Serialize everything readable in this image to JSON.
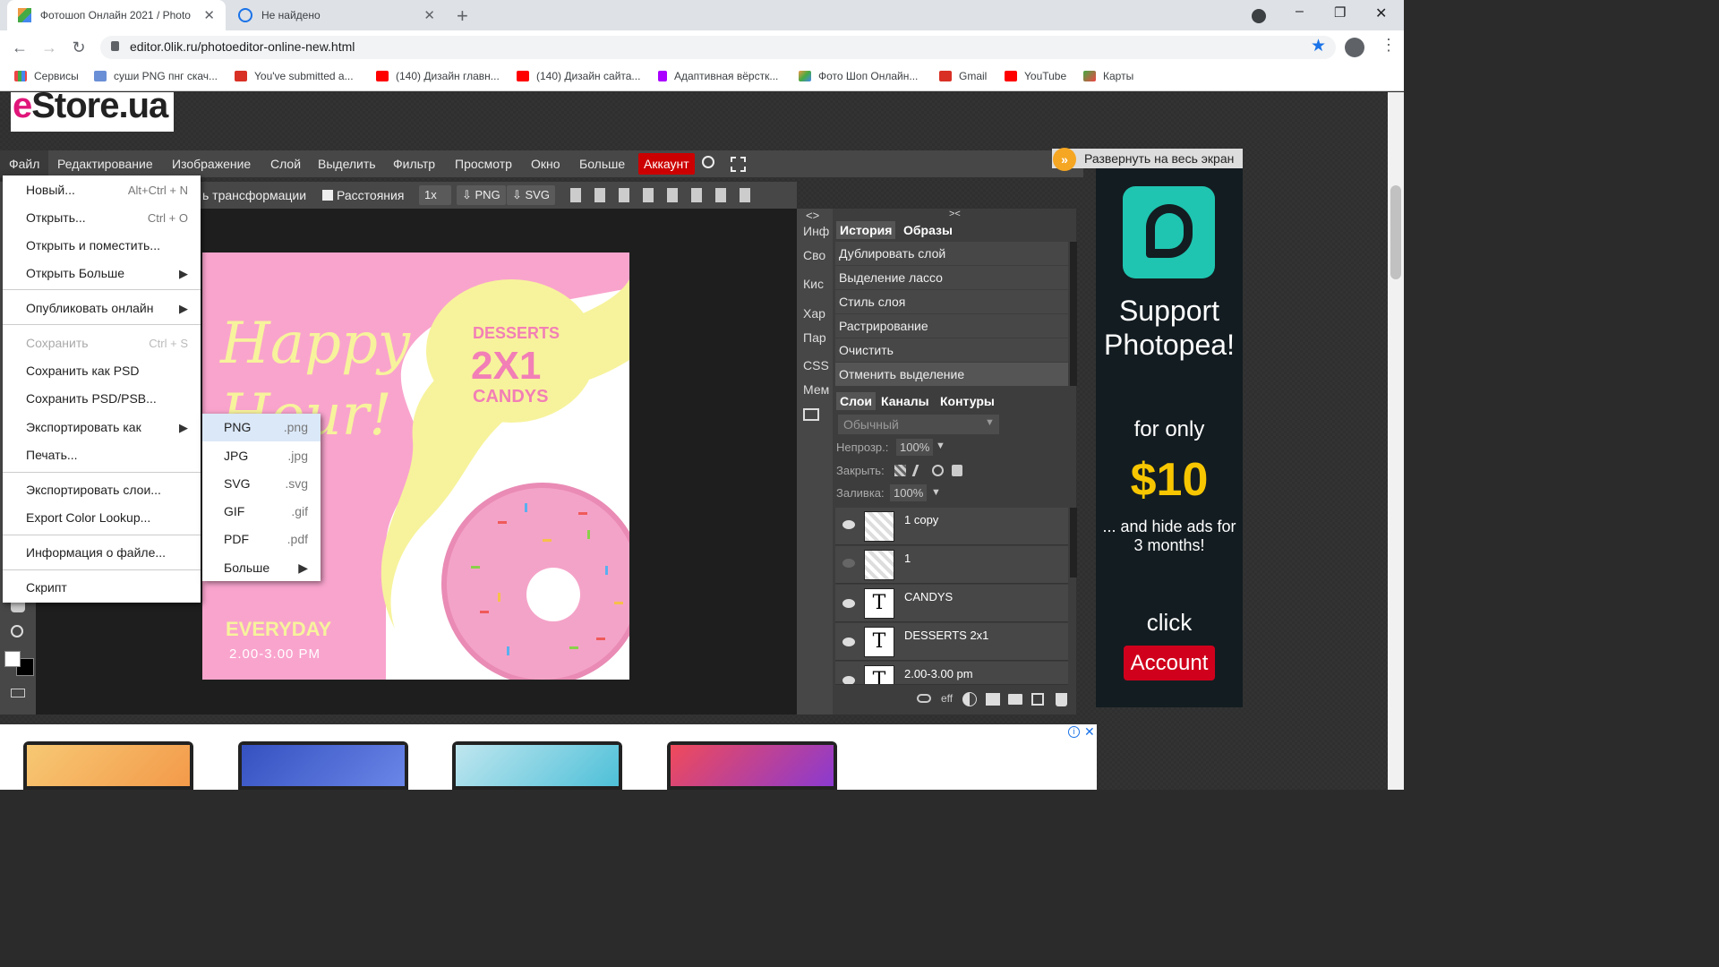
{
  "browser": {
    "tabs": [
      {
        "title": "Фотошоп Онлайн 2021 / Photo",
        "active": true
      },
      {
        "title": "Не найдено",
        "active": false
      }
    ],
    "new_tab": "+",
    "window_controls": [
      "–",
      "❐",
      "✕"
    ],
    "url": "editor.0lik.ru/photoeditor-online-new.html",
    "bookmarks": [
      "Сервисы",
      "суши PNG пнг скач...",
      "You've submitted a...",
      "(140) Дизайн главн...",
      "(140) Дизайн сайта...",
      "Адаптивная вёрстк...",
      "Фото Шоп Онлайн...",
      "Gmail",
      "YouTube",
      "Карты"
    ]
  },
  "site": {
    "logo_prefix": "e",
    "logo_text": "Store.ua"
  },
  "menubar": [
    "Файл",
    "Редактирование",
    "Изображение",
    "Слой",
    "Выделить",
    "Фильтр",
    "Просмотр",
    "Окно",
    "Больше"
  ],
  "account_label": "Аккаунт",
  "options_bar": {
    "transform": "ь трансформации",
    "distances": "Расстояния",
    "zoom": "1x",
    "png": "PNG",
    "svg": "SVG"
  },
  "file_menu": [
    {
      "label": "Новый...",
      "shortcut": "Alt+Ctrl + N"
    },
    {
      "label": "Открыть...",
      "shortcut": "Ctrl + O"
    },
    {
      "label": "Открыть и поместить...",
      "shortcut": ""
    },
    {
      "label": "Открыть Больше",
      "shortcut": "▶"
    },
    {
      "label": "Опубликовать онлайн",
      "shortcut": "▶"
    },
    {
      "label": "Сохранить",
      "shortcut": "Ctrl + S"
    },
    {
      "label": "Сохранить как PSD",
      "shortcut": ""
    },
    {
      "label": "Сохранить PSD/PSB...",
      "shortcut": ""
    },
    {
      "label": "Экспортировать как",
      "shortcut": "▶"
    },
    {
      "label": "Печать...",
      "shortcut": ""
    },
    {
      "label": "Экспортировать слои...",
      "shortcut": ""
    },
    {
      "label": "Export Color Lookup...",
      "shortcut": ""
    },
    {
      "label": "Информация о файле...",
      "shortcut": ""
    },
    {
      "label": "Скрипт",
      "shortcut": ""
    }
  ],
  "export_submenu": [
    {
      "label": "PNG",
      "ext": ".png"
    },
    {
      "label": "JPG",
      "ext": ".jpg"
    },
    {
      "label": "SVG",
      "ext": ".svg"
    },
    {
      "label": "GIF",
      "ext": ".gif"
    },
    {
      "label": "PDF",
      "ext": ".pdf"
    },
    {
      "label": "Больше",
      "ext": "▶"
    }
  ],
  "canvas": {
    "happy": "Happy",
    "hour": "Hour!",
    "desserts": "DESSERTS",
    "deal": "2X1",
    "candys": "CANDYS",
    "everyday": "EVERYDAY",
    "time": "2.00-3.00 PM"
  },
  "side_tabs": [
    "Инф",
    "Сво",
    "Кис",
    "Хар",
    "Пар",
    "CSS",
    "Мем"
  ],
  "panel": {
    "collapse_left": "<>",
    "collapse_right": "><",
    "history_tab": "История",
    "images_tab": "Образы",
    "history": [
      "Дублировать слой",
      "Выделение лассо",
      "Стиль слоя",
      "Растрирование",
      "Очистить",
      "Отменить выделение"
    ],
    "layers_tab": "Слои",
    "channels_tab": "Каналы",
    "paths_tab": "Контуры",
    "blend": "Обычный",
    "opacity_label": "Непрозр.:",
    "opacity": "100%",
    "lock_label": "Закрыть:",
    "fill_label": "Заливка:",
    "fill": "100%",
    "layers": [
      {
        "name": "1 copy",
        "visible": true,
        "type": "raster"
      },
      {
        "name": "1",
        "visible": false,
        "type": "raster"
      },
      {
        "name": "CANDYS",
        "visible": true,
        "type": "text"
      },
      {
        "name": "DESSERTS 2x1",
        "visible": true,
        "type": "text"
      },
      {
        "name": "2.00-3.00 pm",
        "visible": true,
        "type": "text"
      }
    ],
    "eff": "eff"
  },
  "ad": {
    "expand": "Развернуть на весь экран",
    "support": "Support Photopea!",
    "for_only": "for only",
    "price": "$10",
    "hide": "... and hide ads for 3 months!",
    "click": "click",
    "account": "Account"
  },
  "colors": {
    "accent": "#cc0000",
    "pink": "#f9a4cd",
    "yellow": "#f7f39c",
    "ad_teal": "#1fc5b0",
    "ad_price": "#f7c600"
  }
}
